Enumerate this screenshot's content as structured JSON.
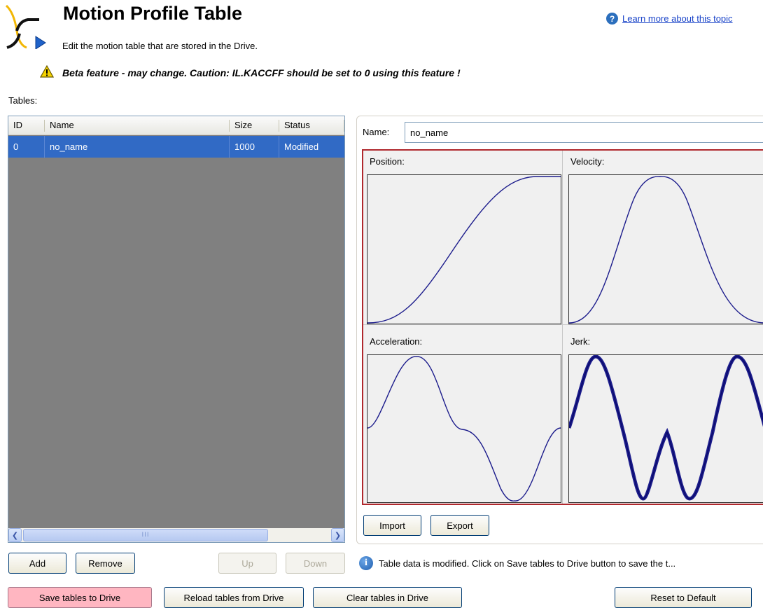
{
  "header": {
    "title": "Motion Profile Table",
    "subtitle": "Edit the motion table that are stored in the Drive.",
    "help_link": "Learn more about this topic",
    "beta_warning": "Beta feature - may change. Caution: IL.KACCFF should be set to 0 using this feature !"
  },
  "tables_label": "Tables:",
  "table_list": {
    "columns": [
      "ID",
      "Name",
      "Size",
      "Status"
    ],
    "rows": [
      {
        "id": "0",
        "name": "no_name",
        "size": "1000",
        "status": "Modified",
        "selected": true
      }
    ],
    "scroll_thumb_glyph": "III"
  },
  "list_buttons": {
    "add": "Add",
    "remove": "Remove",
    "up": "Up",
    "down": "Down"
  },
  "editor": {
    "name_label": "Name:",
    "name_value": "no_name",
    "charts": {
      "position": "Position:",
      "velocity": "Velocity:",
      "acceleration": "Acceleration:",
      "jerk": "Jerk:"
    },
    "import": "Import",
    "export": "Export",
    "info_message": "Table data is modified.  Click on Save tables to Drive button to save the t..."
  },
  "bottom_buttons": {
    "save": "Save tables to Drive",
    "reload": "Reload tables from Drive",
    "clear": "Clear tables in Drive",
    "reset": "Reset to Default"
  },
  "colors": {
    "selection": "#316ac5",
    "list_background": "#808080",
    "chart_frame": "#b0282d",
    "curve": "#1c1c8c",
    "save_button": "#ffb6c1"
  }
}
